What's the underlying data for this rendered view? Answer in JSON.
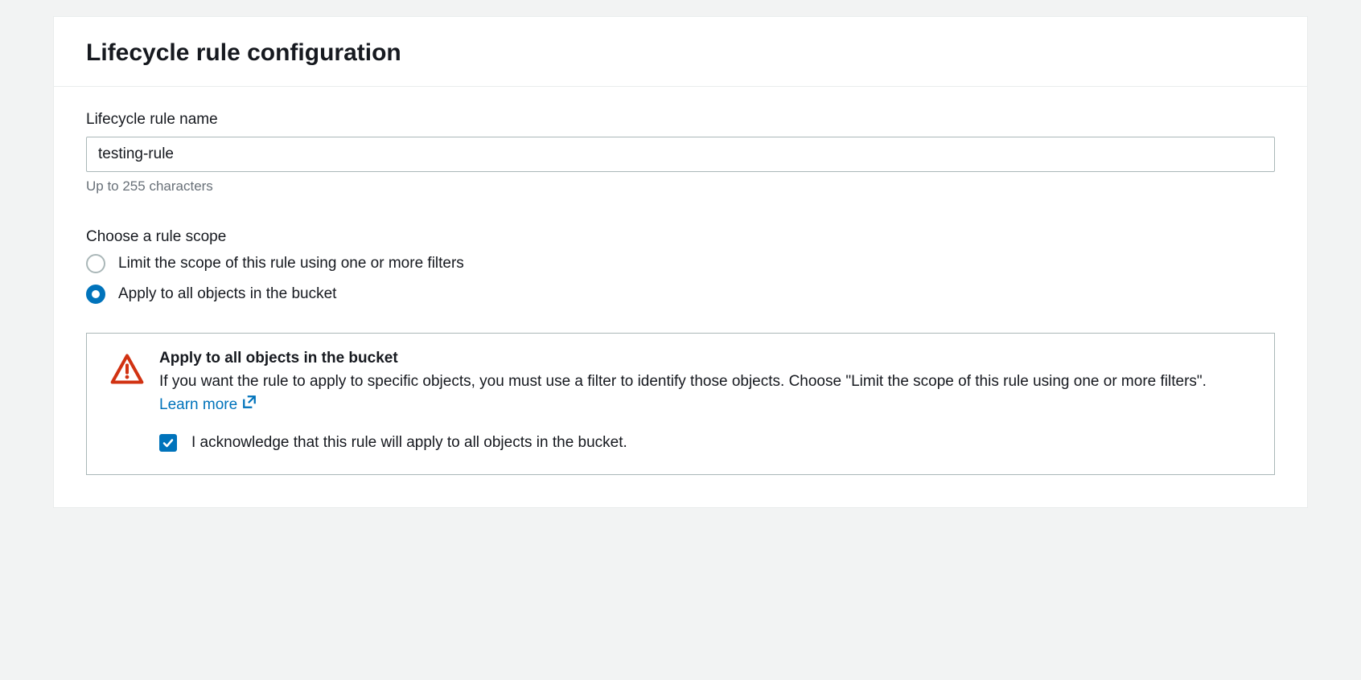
{
  "header": {
    "title": "Lifecycle rule configuration"
  },
  "name_field": {
    "label": "Lifecycle rule name",
    "value": "testing-rule",
    "help": "Up to 255 characters"
  },
  "scope": {
    "label": "Choose a rule scope",
    "options": [
      {
        "label": "Limit the scope of this rule using one or more filters",
        "selected": false
      },
      {
        "label": "Apply to all objects in the bucket",
        "selected": true
      }
    ]
  },
  "warning": {
    "title": "Apply to all objects in the bucket",
    "text_before_link": "If you want the rule to apply to specific objects, you must use a filter to identify those objects. Choose \"Limit the scope of this rule using one or more filters\". ",
    "link_text": "Learn more",
    "ack_label": "I acknowledge that this rule will apply to all objects in the bucket.",
    "ack_checked": true
  }
}
